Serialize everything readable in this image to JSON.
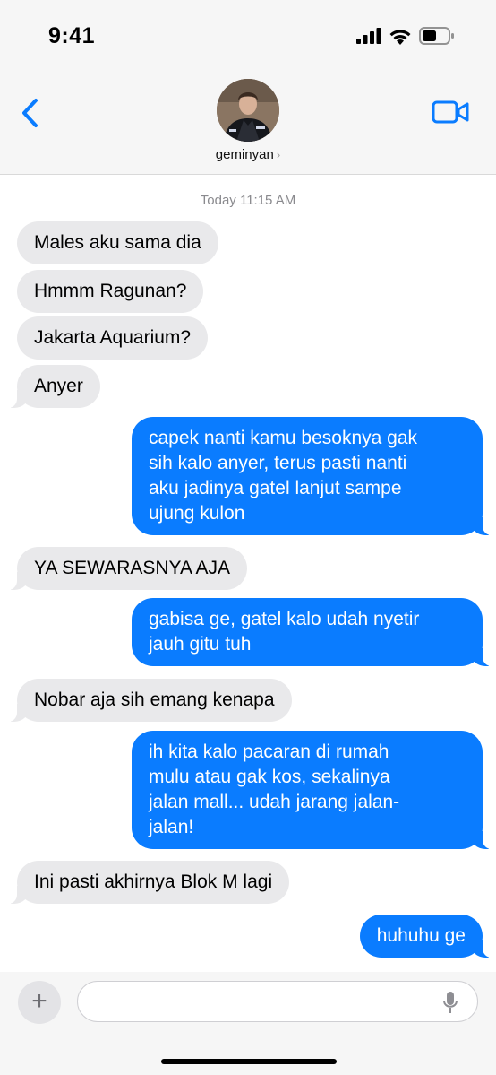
{
  "status_bar": {
    "time": "9:41"
  },
  "header": {
    "contact_name": "geminyan",
    "chevron": "›"
  },
  "conversation": {
    "timestamp": "Today 11:15 AM",
    "messages": [
      {
        "from": "them",
        "text": "Males aku sama dia"
      },
      {
        "from": "them",
        "text": "Hmmm Ragunan?"
      },
      {
        "from": "them",
        "text": "Jakarta Aquarium?"
      },
      {
        "from": "them",
        "text": "Anyer"
      },
      {
        "from": "me",
        "lines": [
          "capek nanti kamu besoknya gak",
          "sih kalo anyer, terus pasti nanti",
          "aku jadinya gatel lanjut sampe",
          "ujung kulon"
        ]
      },
      {
        "from": "them",
        "text": "YA SEWARASNYA AJA"
      },
      {
        "from": "me",
        "lines": [
          "gabisa ge, gatel kalo udah nyetir",
          "jauh gitu tuh"
        ]
      },
      {
        "from": "them",
        "text": "Nobar aja sih emang kenapa"
      },
      {
        "from": "me",
        "lines": [
          "ih kita kalo pacaran di rumah",
          "mulu atau gak kos, sekalinya",
          "jalan mall... udah jarang jalan-",
          "jalan!"
        ]
      },
      {
        "from": "them",
        "text": "Ini pasti akhirnya Blok M lagi"
      },
      {
        "from": "me",
        "text": "huhuhu ge"
      }
    ]
  },
  "composer": {
    "plus_label": "+",
    "placeholder": ""
  },
  "colors": {
    "outgoing": "#0a7cff",
    "incoming": "#e9e9eb",
    "accent": "#0a7cff"
  },
  "icons": [
    "back-chevron-icon",
    "video-camera-icon",
    "signal-icon",
    "wifi-icon",
    "battery-icon",
    "plus-icon",
    "microphone-icon"
  ]
}
